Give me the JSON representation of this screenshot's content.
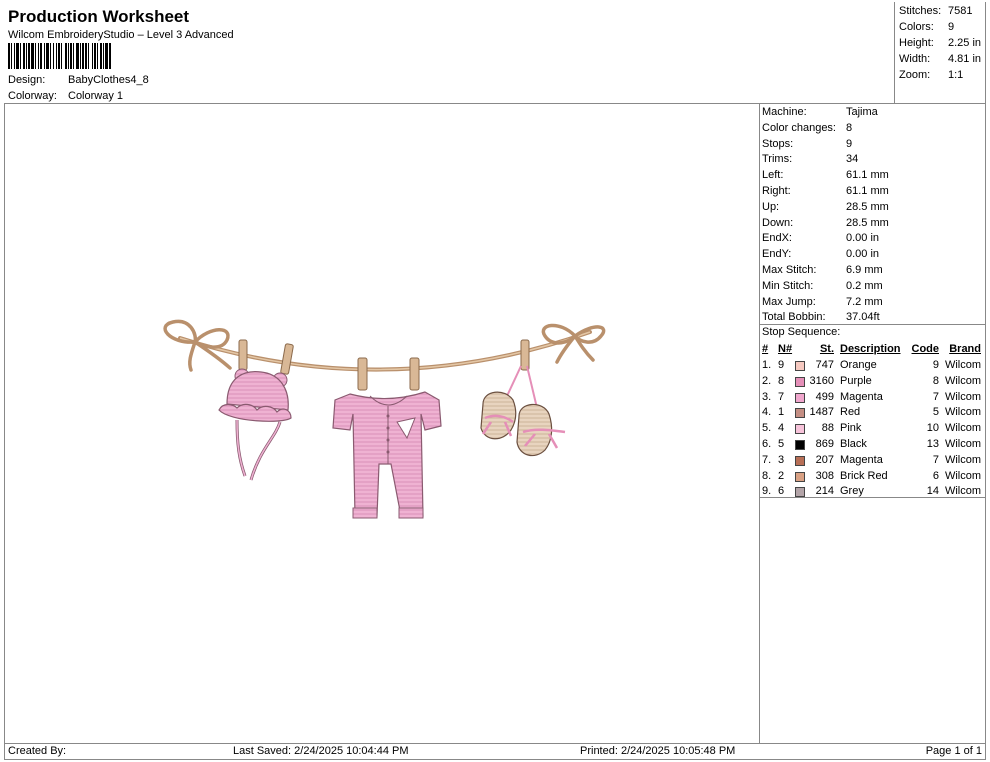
{
  "header": {
    "title": "Production Worksheet",
    "subtitle": "Wilcom EmbroideryStudio – Level 3 Advanced",
    "design_label": "Design:",
    "design_value": "BabyClothes4_8",
    "colorway_label": "Colorway:",
    "colorway_value": "Colorway 1"
  },
  "stats": [
    {
      "label": "Stitches:",
      "value": "7581"
    },
    {
      "label": "Colors:",
      "value": "9"
    },
    {
      "label": "Height:",
      "value": "2.25 in"
    },
    {
      "label": "Width:",
      "value": "4.81 in"
    },
    {
      "label": "Zoom:",
      "value": "1:1"
    }
  ],
  "machine_info": [
    {
      "label": "Machine:",
      "value": "Tajima"
    },
    {
      "label": "Color changes:",
      "value": "8"
    },
    {
      "label": "Stops:",
      "value": "9"
    },
    {
      "label": "Trims:",
      "value": "34"
    },
    {
      "label": "Left:",
      "value": "61.1 mm"
    },
    {
      "label": "Right:",
      "value": "61.1 mm"
    },
    {
      "label": "Up:",
      "value": "28.5 mm"
    },
    {
      "label": "Down:",
      "value": "28.5 mm"
    },
    {
      "label": "EndX:",
      "value": "0.00 in"
    },
    {
      "label": "EndY:",
      "value": "0.00 in"
    },
    {
      "label": "Max Stitch:",
      "value": "6.9 mm"
    },
    {
      "label": "Min Stitch:",
      "value": "0.2 mm"
    },
    {
      "label": "Max Jump:",
      "value": "7.2 mm"
    },
    {
      "label": "Total Bobbin:",
      "value": "37.04ft"
    }
  ],
  "stop_sequence": {
    "title": "Stop Sequence:",
    "headers": {
      "num": "#",
      "n": "N#",
      "st": "St.",
      "desc": "Description",
      "code": "Code",
      "brand": "Brand"
    },
    "rows": [
      {
        "num": "1.",
        "n": "9",
        "st": "747",
        "desc": "Orange",
        "code": "9",
        "brand": "Wilcom",
        "color": "#f6c9c0"
      },
      {
        "num": "2.",
        "n": "8",
        "st": "3160",
        "desc": "Purple",
        "code": "8",
        "brand": "Wilcom",
        "color": "#e58fb8"
      },
      {
        "num": "3.",
        "n": "7",
        "st": "499",
        "desc": "Magenta",
        "code": "7",
        "brand": "Wilcom",
        "color": "#f0a6cd"
      },
      {
        "num": "4.",
        "n": "1",
        "st": "1487",
        "desc": "Red",
        "code": "5",
        "brand": "Wilcom",
        "color": "#c48e83"
      },
      {
        "num": "5.",
        "n": "4",
        "st": "88",
        "desc": "Pink",
        "code": "10",
        "brand": "Wilcom",
        "color": "#f7c3da"
      },
      {
        "num": "6.",
        "n": "5",
        "st": "869",
        "desc": "Black",
        "code": "13",
        "brand": "Wilcom",
        "color": "#000000"
      },
      {
        "num": "7.",
        "n": "3",
        "st": "207",
        "desc": "Magenta",
        "code": "7",
        "brand": "Wilcom",
        "color": "#b86f56"
      },
      {
        "num": "8.",
        "n": "2",
        "st": "308",
        "desc": "Brick Red",
        "code": "6",
        "brand": "Wilcom",
        "color": "#d9a184"
      },
      {
        "num": "9.",
        "n": "6",
        "st": "214",
        "desc": "Grey",
        "code": "14",
        "brand": "Wilcom",
        "color": "#b3a4a8"
      }
    ]
  },
  "footer": {
    "created_by": "Created By:",
    "last_saved": "Last Saved: 2/24/2025 10:04:44 PM",
    "printed": "Printed: 2/24/2025 10:05:48 PM",
    "page": "Page 1 of 1"
  }
}
